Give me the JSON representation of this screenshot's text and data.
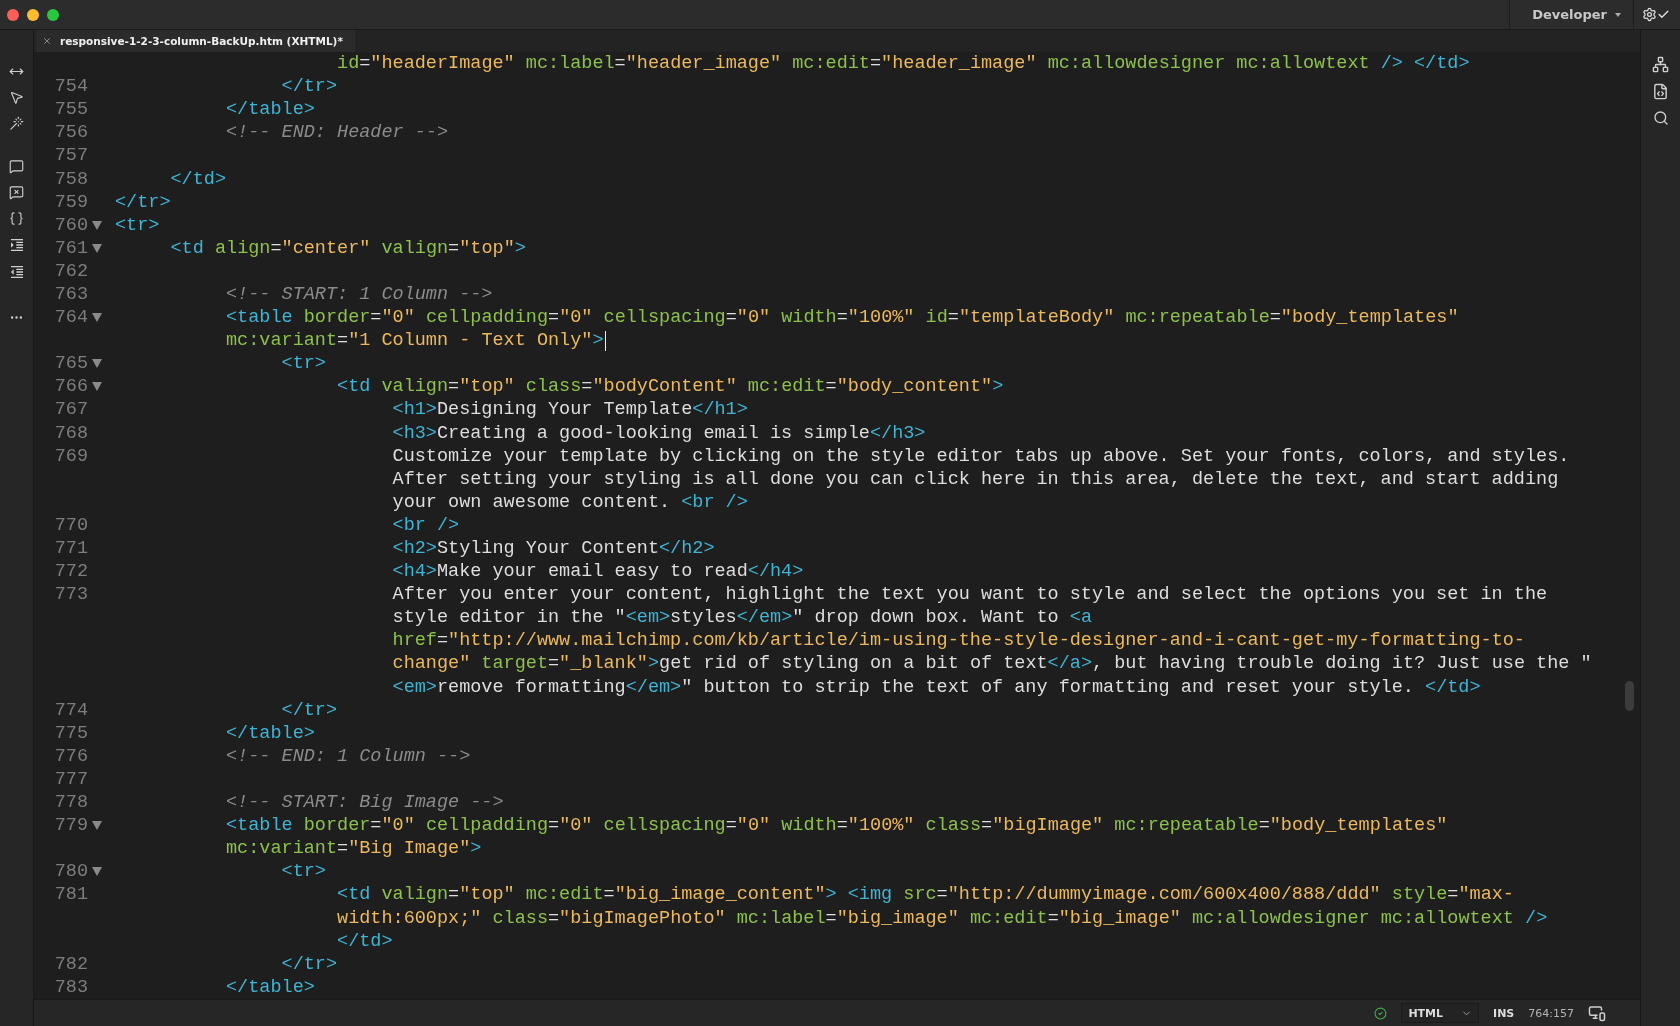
{
  "window": {
    "workspace": "Developer"
  },
  "tab": {
    "title": "responsive-1-2-3-column-BackUp.htm (XHTML)*"
  },
  "lines": [
    {
      "rows": [
        {
          "tokens": [
            {
              "kind": "attr",
              "text": "                    id"
            },
            {
              "kind": "text",
              "text": "="
            },
            {
              "kind": "str",
              "text": "\"headerImage\""
            },
            {
              "kind": "attr",
              "text": " mc:label"
            },
            {
              "kind": "text",
              "text": "="
            },
            {
              "kind": "str",
              "text": "\"header_image\""
            },
            {
              "kind": "attr",
              "text": " mc:edit"
            },
            {
              "kind": "text",
              "text": "="
            },
            {
              "kind": "str",
              "text": "\"header_image\""
            },
            {
              "kind": "attr",
              "text": " mc:allowdesigner mc:allowtext"
            },
            {
              "kind": "tag",
              "text": " /> </td>"
            }
          ]
        }
      ]
    },
    {
      "number": "754",
      "foldable": false,
      "rows": [
        {
          "tokens": [
            {
              "kind": "tag",
              "text": "               </tr>"
            }
          ]
        }
      ]
    },
    {
      "number": "755",
      "foldable": false,
      "rows": [
        {
          "tokens": [
            {
              "kind": "tag",
              "text": "          </table>"
            }
          ]
        }
      ]
    },
    {
      "number": "756",
      "foldable": false,
      "rows": [
        {
          "tokens": [
            {
              "kind": "comment",
              "text": "          <!-- END: Header -->"
            }
          ]
        }
      ]
    },
    {
      "number": "757",
      "foldable": false
    },
    {
      "number": "758",
      "foldable": false,
      "rows": [
        {
          "tokens": [
            {
              "kind": "tag",
              "text": "     </td>"
            }
          ]
        }
      ]
    },
    {
      "number": "759",
      "foldable": false,
      "rows": [
        {
          "tokens": [
            {
              "kind": "tag",
              "text": "</tr>"
            }
          ]
        }
      ]
    },
    {
      "number": "760",
      "foldable": true,
      "rows": [
        {
          "tokens": [
            {
              "kind": "tag",
              "text": "<tr>"
            }
          ]
        }
      ]
    },
    {
      "number": "761",
      "foldable": true,
      "rows": [
        {
          "tokens": [
            {
              "kind": "tag",
              "text": "     <td"
            },
            {
              "kind": "attr",
              "text": " align"
            },
            {
              "kind": "text",
              "text": "="
            },
            {
              "kind": "str",
              "text": "\"center\""
            },
            {
              "kind": "attr",
              "text": " valign"
            },
            {
              "kind": "text",
              "text": "="
            },
            {
              "kind": "str",
              "text": "\"top\""
            },
            {
              "kind": "tag",
              "text": ">"
            }
          ]
        }
      ]
    },
    {
      "number": "762",
      "foldable": false
    },
    {
      "number": "763",
      "foldable": false,
      "rows": [
        {
          "tokens": [
            {
              "kind": "comment",
              "text": "          <!-- START: 1 Column -->"
            }
          ]
        }
      ]
    },
    {
      "number": "764",
      "foldable": true,
      "rows": [
        {
          "tokens": [
            {
              "kind": "tag",
              "text": "          <table"
            },
            {
              "kind": "attr",
              "text": " border"
            },
            {
              "kind": "text",
              "text": "="
            },
            {
              "kind": "str",
              "text": "\"0\""
            },
            {
              "kind": "attr",
              "text": " cellpadding"
            },
            {
              "kind": "text",
              "text": "="
            },
            {
              "kind": "str",
              "text": "\"0\""
            },
            {
              "kind": "attr",
              "text": " cellspacing"
            },
            {
              "kind": "text",
              "text": "="
            },
            {
              "kind": "str",
              "text": "\"0\""
            },
            {
              "kind": "attr",
              "text": " width"
            },
            {
              "kind": "text",
              "text": "="
            },
            {
              "kind": "str",
              "text": "\"100%\""
            },
            {
              "kind": "attr",
              "text": " id"
            },
            {
              "kind": "text",
              "text": "="
            },
            {
              "kind": "str",
              "text": "\"templateBody\""
            },
            {
              "kind": "attr",
              "text": " mc:repeatable"
            },
            {
              "kind": "text",
              "text": "="
            },
            {
              "kind": "str",
              "text": "\"body_templates\""
            }
          ]
        },
        {
          "caret": true,
          "tokens": [
            {
              "kind": "attr",
              "text": "          mc:variant"
            },
            {
              "kind": "text",
              "text": "="
            },
            {
              "kind": "str",
              "text": "\"1 Column - Text Only\""
            },
            {
              "kind": "tag",
              "text": ">"
            }
          ]
        }
      ]
    },
    {
      "number": "765",
      "foldable": true,
      "rows": [
        {
          "tokens": [
            {
              "kind": "tag",
              "text": "               <tr>"
            }
          ]
        }
      ]
    },
    {
      "number": "766",
      "foldable": true,
      "rows": [
        {
          "tokens": [
            {
              "kind": "tag",
              "text": "                    <td"
            },
            {
              "kind": "attr",
              "text": " valign"
            },
            {
              "kind": "text",
              "text": "="
            },
            {
              "kind": "str",
              "text": "\"top\""
            },
            {
              "kind": "attr",
              "text": " class"
            },
            {
              "kind": "text",
              "text": "="
            },
            {
              "kind": "str",
              "text": "\"bodyContent\""
            },
            {
              "kind": "attr",
              "text": " mc:edit"
            },
            {
              "kind": "text",
              "text": "="
            },
            {
              "kind": "str",
              "text": "\"body_content\""
            },
            {
              "kind": "tag",
              "text": ">"
            }
          ]
        }
      ]
    },
    {
      "number": "767",
      "foldable": false,
      "rows": [
        {
          "tokens": [
            {
              "kind": "tag",
              "text": "                         <h1>"
            },
            {
              "kind": "text",
              "text": "Designing Your Template"
            },
            {
              "kind": "tag",
              "text": "</h1>"
            }
          ]
        }
      ]
    },
    {
      "number": "768",
      "foldable": false,
      "rows": [
        {
          "tokens": [
            {
              "kind": "tag",
              "text": "                         <h3>"
            },
            {
              "kind": "text",
              "text": "Creating a good-looking email is simple"
            },
            {
              "kind": "tag",
              "text": "</h3>"
            }
          ]
        }
      ]
    },
    {
      "number": "769",
      "foldable": false,
      "rows": [
        {
          "tokens": [
            {
              "kind": "text",
              "text": "                         Customize your template by clicking on the style editor tabs up above. Set your fonts, colors, and styles."
            }
          ]
        },
        {
          "tokens": [
            {
              "kind": "text",
              "text": "                         After setting your styling is all done you can click here in this area, delete the text, and start adding"
            }
          ]
        },
        {
          "tokens": [
            {
              "kind": "text",
              "text": "                         your own awesome content. "
            },
            {
              "kind": "tag",
              "text": "<br />"
            }
          ]
        }
      ]
    },
    {
      "number": "770",
      "foldable": false,
      "rows": [
        {
          "tokens": [
            {
              "kind": "tag",
              "text": "                         <br />"
            }
          ]
        }
      ]
    },
    {
      "number": "771",
      "foldable": false,
      "rows": [
        {
          "tokens": [
            {
              "kind": "tag",
              "text": "                         <h2>"
            },
            {
              "kind": "text",
              "text": "Styling Your Content"
            },
            {
              "kind": "tag",
              "text": "</h2>"
            }
          ]
        }
      ]
    },
    {
      "number": "772",
      "foldable": false,
      "rows": [
        {
          "tokens": [
            {
              "kind": "tag",
              "text": "                         <h4>"
            },
            {
              "kind": "text",
              "text": "Make your email easy to read"
            },
            {
              "kind": "tag",
              "text": "</h4>"
            }
          ]
        }
      ]
    },
    {
      "number": "773",
      "foldable": false,
      "rows": [
        {
          "tokens": [
            {
              "kind": "text",
              "text": "                         After you enter your content, highlight the text you want to style and select the options you set in the"
            }
          ]
        },
        {
          "tokens": [
            {
              "kind": "text",
              "text": "                         style editor in the \""
            },
            {
              "kind": "tag",
              "text": "<em>"
            },
            {
              "kind": "text",
              "text": "styles"
            },
            {
              "kind": "tag",
              "text": "</em>"
            },
            {
              "kind": "text",
              "text": "\" drop down box. Want to "
            },
            {
              "kind": "tag",
              "text": "<a"
            }
          ]
        },
        {
          "tokens": [
            {
              "kind": "attr",
              "text": "                         href"
            },
            {
              "kind": "text",
              "text": "="
            },
            {
              "kind": "str",
              "text": "\"http://www.mailchimp.com/kb/article/im-using-the-style-designer-and-i-cant-get-my-formatting-to-"
            }
          ]
        },
        {
          "tokens": [
            {
              "kind": "str",
              "text": "                         change\""
            },
            {
              "kind": "attr",
              "text": " target"
            },
            {
              "kind": "text",
              "text": "="
            },
            {
              "kind": "str",
              "text": "\"_blank\""
            },
            {
              "kind": "tag",
              "text": ">"
            },
            {
              "kind": "text",
              "text": "get rid of styling on a bit of text"
            },
            {
              "kind": "tag",
              "text": "</a>"
            },
            {
              "kind": "text",
              "text": ", but having trouble doing it? Just use the \""
            }
          ]
        },
        {
          "tokens": [
            {
              "kind": "tag",
              "text": "                         <em>"
            },
            {
              "kind": "text",
              "text": "remove formatting"
            },
            {
              "kind": "tag",
              "text": "</em>"
            },
            {
              "kind": "text",
              "text": "\" button to strip the text of any formatting and reset your style. "
            },
            {
              "kind": "tag",
              "text": "</td>"
            }
          ]
        }
      ]
    },
    {
      "number": "774",
      "foldable": false,
      "rows": [
        {
          "tokens": [
            {
              "kind": "tag",
              "text": "               </tr>"
            }
          ]
        }
      ]
    },
    {
      "number": "775",
      "foldable": false,
      "rows": [
        {
          "tokens": [
            {
              "kind": "tag",
              "text": "          </table>"
            }
          ]
        }
      ]
    },
    {
      "number": "776",
      "foldable": false,
      "rows": [
        {
          "tokens": [
            {
              "kind": "comment",
              "text": "          <!-- END: 1 Column -->"
            }
          ]
        }
      ]
    },
    {
      "number": "777",
      "foldable": false
    },
    {
      "number": "778",
      "foldable": false,
      "rows": [
        {
          "tokens": [
            {
              "kind": "comment",
              "text": "          <!-- START: Big Image -->"
            }
          ]
        }
      ]
    },
    {
      "number": "779",
      "foldable": true,
      "rows": [
        {
          "tokens": [
            {
              "kind": "tag",
              "text": "          <table"
            },
            {
              "kind": "attr",
              "text": " border"
            },
            {
              "kind": "text",
              "text": "="
            },
            {
              "kind": "str",
              "text": "\"0\""
            },
            {
              "kind": "attr",
              "text": " cellpadding"
            },
            {
              "kind": "text",
              "text": "="
            },
            {
              "kind": "str",
              "text": "\"0\""
            },
            {
              "kind": "attr",
              "text": " cellspacing"
            },
            {
              "kind": "text",
              "text": "="
            },
            {
              "kind": "str",
              "text": "\"0\""
            },
            {
              "kind": "attr",
              "text": " width"
            },
            {
              "kind": "text",
              "text": "="
            },
            {
              "kind": "str",
              "text": "\"100%\""
            },
            {
              "kind": "attr",
              "text": " class"
            },
            {
              "kind": "text",
              "text": "="
            },
            {
              "kind": "str",
              "text": "\"bigImage\""
            },
            {
              "kind": "attr",
              "text": " mc:repeatable"
            },
            {
              "kind": "text",
              "text": "="
            },
            {
              "kind": "str",
              "text": "\"body_templates\""
            }
          ]
        },
        {
          "tokens": [
            {
              "kind": "attr",
              "text": "          mc:variant"
            },
            {
              "kind": "text",
              "text": "="
            },
            {
              "kind": "str",
              "text": "\"Big Image\""
            },
            {
              "kind": "tag",
              "text": ">"
            }
          ]
        }
      ]
    },
    {
      "number": "780",
      "foldable": true,
      "rows": [
        {
          "tokens": [
            {
              "kind": "tag",
              "text": "               <tr>"
            }
          ]
        }
      ]
    },
    {
      "number": "781",
      "foldable": false,
      "rows": [
        {
          "tokens": [
            {
              "kind": "tag",
              "text": "                    <td"
            },
            {
              "kind": "attr",
              "text": " valign"
            },
            {
              "kind": "text",
              "text": "="
            },
            {
              "kind": "str",
              "text": "\"top\""
            },
            {
              "kind": "attr",
              "text": " mc:edit"
            },
            {
              "kind": "text",
              "text": "="
            },
            {
              "kind": "str",
              "text": "\"big_image_content\""
            },
            {
              "kind": "tag",
              "text": "> <img"
            },
            {
              "kind": "attr",
              "text": " src"
            },
            {
              "kind": "text",
              "text": "="
            },
            {
              "kind": "str",
              "text": "\"http://dummyimage.com/600x400/888/ddd\""
            },
            {
              "kind": "attr",
              "text": " style"
            },
            {
              "kind": "text",
              "text": "="
            },
            {
              "kind": "str",
              "text": "\"max-"
            }
          ]
        },
        {
          "tokens": [
            {
              "kind": "str",
              "text": "                    width:600px;\""
            },
            {
              "kind": "attr",
              "text": " class"
            },
            {
              "kind": "text",
              "text": "="
            },
            {
              "kind": "str",
              "text": "\"bigImagePhoto\""
            },
            {
              "kind": "attr",
              "text": " mc:label"
            },
            {
              "kind": "text",
              "text": "="
            },
            {
              "kind": "str",
              "text": "\"big_image\""
            },
            {
              "kind": "attr",
              "text": " mc:edit"
            },
            {
              "kind": "text",
              "text": "="
            },
            {
              "kind": "str",
              "text": "\"big_image\""
            },
            {
              "kind": "attr",
              "text": " mc:allowdesigner mc:allowtext"
            },
            {
              "kind": "tag",
              "text": " />"
            }
          ]
        },
        {
          "tokens": [
            {
              "kind": "tag",
              "text": "                    </td>"
            }
          ]
        }
      ]
    },
    {
      "number": "782",
      "foldable": false,
      "rows": [
        {
          "tokens": [
            {
              "kind": "tag",
              "text": "               </tr>"
            }
          ]
        }
      ]
    },
    {
      "number": "783",
      "foldable": false,
      "rows": [
        {
          "tokens": [
            {
              "kind": "tag",
              "text": "          </table>"
            }
          ]
        }
      ]
    }
  ],
  "status_bar": {
    "language": "HTML",
    "mode": "INS",
    "position": "764:157"
  }
}
